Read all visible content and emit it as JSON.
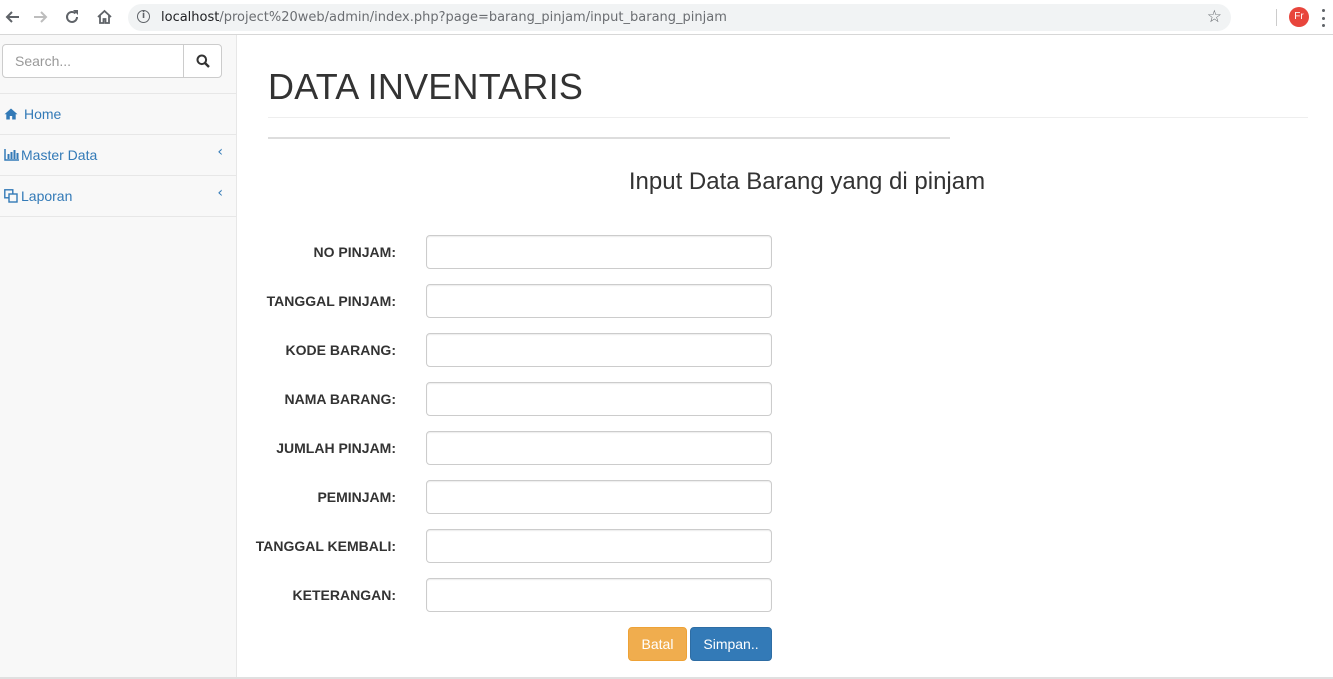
{
  "browser": {
    "url_host": "localhost",
    "url_path": "/project%20web/admin/index.php?page=barang_pinjam/input_barang_pinjam",
    "profile_initials": "Fr",
    "icons": [
      "back-icon",
      "forward-icon",
      "reload-icon",
      "home-icon",
      "info-icon",
      "star-icon",
      "menu-icon"
    ]
  },
  "sidebar": {
    "search_placeholder": "Search...",
    "items": [
      {
        "label": "Home",
        "icon": "home-icon",
        "has_caret": false
      },
      {
        "label": "Master Data",
        "icon": "bar-chart-icon",
        "has_caret": true
      },
      {
        "label": "Laporan",
        "icon": "copy-icon",
        "has_caret": true
      }
    ]
  },
  "main": {
    "page_title": "DATA INVENTARIS",
    "form_title": "Input Data Barang yang di pinjam",
    "fields": [
      {
        "label": "NO PINJAM:",
        "value": ""
      },
      {
        "label": "TANGGAL PINJAM:",
        "value": ""
      },
      {
        "label": "KODE BARANG:",
        "value": ""
      },
      {
        "label": "NAMA BARANG:",
        "value": ""
      },
      {
        "label": "JUMLAH PINJAM:",
        "value": ""
      },
      {
        "label": "PEMINJAM:",
        "value": ""
      },
      {
        "label": "TANGGAL KEMBALI:",
        "value": ""
      },
      {
        "label": "KETERANGAN:",
        "value": ""
      }
    ],
    "buttons": {
      "cancel": "Batal",
      "save": "Simpan.."
    }
  },
  "colors": {
    "link": "#337ab7",
    "warning": "#f0ad4e",
    "primary": "#337ab7",
    "sidebar_bg": "#f8f8f8"
  }
}
